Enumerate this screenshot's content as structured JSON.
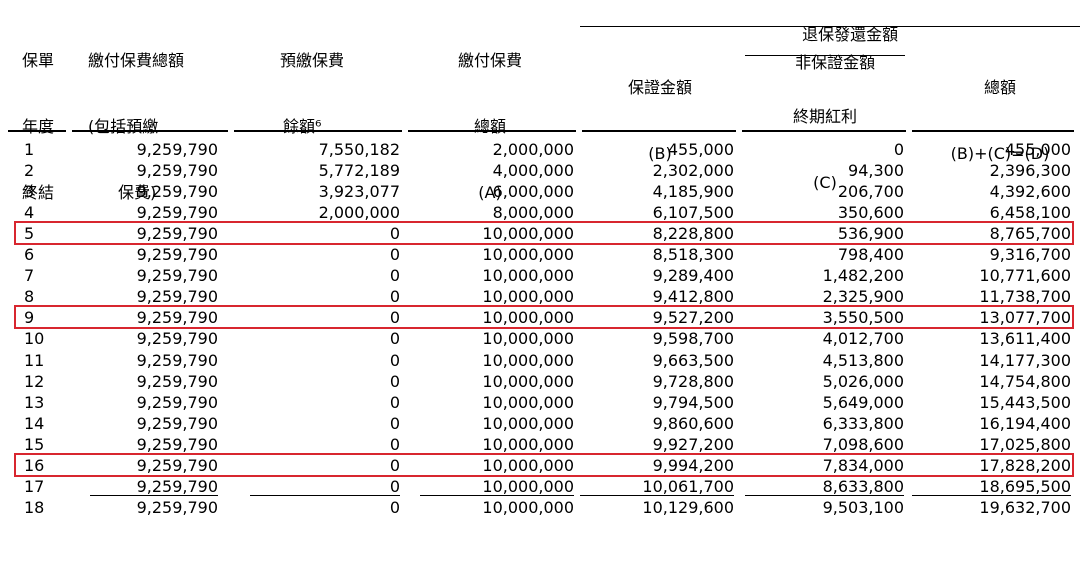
{
  "header": {
    "col_year": [
      "保單",
      "年度",
      "終結"
    ],
    "col_total_premium": [
      "繳付保費總額",
      "(包括預繳",
      "保費)"
    ],
    "col_prepaid": [
      "預繳保費",
      "餘額⁶"
    ],
    "col_paid": [
      "繳付保費",
      "總額",
      "(A)"
    ],
    "surrender_group": "退保發還金額",
    "col_guaranteed": [
      "保證金額",
      "(B)"
    ],
    "col_non_guaranteed": "非保證金額",
    "col_terminal": [
      "終期紅利",
      "(C)"
    ],
    "col_total": [
      "總額",
      "(B)+(C)=(D)"
    ]
  },
  "rows": [
    {
      "year": "1",
      "total_premium": "9,259,790",
      "prepaid": "7,550,182",
      "paid": "2,000,000",
      "guaranteed": "455,000",
      "terminal": "0",
      "total": "455,000"
    },
    {
      "year": "2",
      "total_premium": "9,259,790",
      "prepaid": "5,772,189",
      "paid": "4,000,000",
      "guaranteed": "2,302,000",
      "terminal": "94,300",
      "total": "2,396,300"
    },
    {
      "year": "3",
      "total_premium": "9,259,790",
      "prepaid": "3,923,077",
      "paid": "6,000,000",
      "guaranteed": "4,185,900",
      "terminal": "206,700",
      "total": "4,392,600"
    },
    {
      "year": "4",
      "total_premium": "9,259,790",
      "prepaid": "2,000,000",
      "paid": "8,000,000",
      "guaranteed": "6,107,500",
      "terminal": "350,600",
      "total": "6,458,100"
    },
    {
      "year": "5",
      "total_premium": "9,259,790",
      "prepaid": "0",
      "paid": "10,000,000",
      "guaranteed": "8,228,800",
      "terminal": "536,900",
      "total": "8,765,700",
      "highlight": true
    },
    {
      "year": "6",
      "total_premium": "9,259,790",
      "prepaid": "0",
      "paid": "10,000,000",
      "guaranteed": "8,518,300",
      "terminal": "798,400",
      "total": "9,316,700"
    },
    {
      "year": "7",
      "total_premium": "9,259,790",
      "prepaid": "0",
      "paid": "10,000,000",
      "guaranteed": "9,289,400",
      "terminal": "1,482,200",
      "total": "10,771,600"
    },
    {
      "year": "8",
      "total_premium": "9,259,790",
      "prepaid": "0",
      "paid": "10,000,000",
      "guaranteed": "9,412,800",
      "terminal": "2,325,900",
      "total": "11,738,700"
    },
    {
      "year": "9",
      "total_premium": "9,259,790",
      "prepaid": "0",
      "paid": "10,000,000",
      "guaranteed": "9,527,200",
      "terminal": "3,550,500",
      "total": "13,077,700",
      "highlight": true
    },
    {
      "year": "10",
      "total_premium": "9,259,790",
      "prepaid": "0",
      "paid": "10,000,000",
      "guaranteed": "9,598,700",
      "terminal": "4,012,700",
      "total": "13,611,400"
    },
    {
      "year": "11",
      "total_premium": "9,259,790",
      "prepaid": "0",
      "paid": "10,000,000",
      "guaranteed": "9,663,500",
      "terminal": "4,513,800",
      "total": "14,177,300"
    },
    {
      "year": "12",
      "total_premium": "9,259,790",
      "prepaid": "0",
      "paid": "10,000,000",
      "guaranteed": "9,728,800",
      "terminal": "5,026,000",
      "total": "14,754,800"
    },
    {
      "year": "13",
      "total_premium": "9,259,790",
      "prepaid": "0",
      "paid": "10,000,000",
      "guaranteed": "9,794,500",
      "terminal": "5,649,000",
      "total": "15,443,500"
    },
    {
      "year": "14",
      "total_premium": "9,259,790",
      "prepaid": "0",
      "paid": "10,000,000",
      "guaranteed": "9,860,600",
      "terminal": "6,333,800",
      "total": "16,194,400"
    },
    {
      "year": "15",
      "total_premium": "9,259,790",
      "prepaid": "0",
      "paid": "10,000,000",
      "guaranteed": "9,927,200",
      "terminal": "7,098,600",
      "total": "17,025,800"
    },
    {
      "year": "16",
      "total_premium": "9,259,790",
      "prepaid": "0",
      "paid": "10,000,000",
      "guaranteed": "9,994,200",
      "terminal": "7,834,000",
      "total": "17,828,200",
      "highlight": true
    },
    {
      "year": "17",
      "total_premium": "9,259,790",
      "prepaid": "0",
      "paid": "10,000,000",
      "guaranteed": "10,061,700",
      "terminal": "8,633,800",
      "total": "18,695,500"
    },
    {
      "year": "18",
      "total_premium": "9,259,790",
      "prepaid": "0",
      "paid": "10,000,000",
      "guaranteed": "10,129,600",
      "terminal": "9,503,100",
      "total": "19,632,700"
    }
  ],
  "colors": {
    "highlight_border": "#d8262f",
    "text": "#000000"
  }
}
